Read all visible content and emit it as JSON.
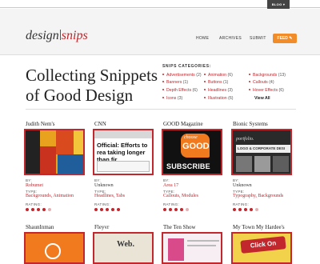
{
  "topbar": {
    "blog_label": "BLOG ▾"
  },
  "header": {
    "logo_left": "design",
    "logo_right": "snips",
    "nav": [
      "HOME",
      "ARCHIVES",
      "SUBMIT"
    ],
    "feed_label": "FEED ✎"
  },
  "hero": {
    "headline": "Collecting Snippets of Good Design"
  },
  "categories": {
    "title": "SNIPS CATEGORIES:",
    "items": [
      {
        "label": "Advertisements",
        "count": "(2)"
      },
      {
        "label": "Banners",
        "count": "(1)"
      },
      {
        "label": "Depth Effects",
        "count": "(6)"
      },
      {
        "label": "Icons",
        "count": "(3)"
      },
      {
        "label": "Animation",
        "count": "(6)"
      },
      {
        "label": "Buttons",
        "count": "(1)"
      },
      {
        "label": "Headlines",
        "count": "(3)"
      },
      {
        "label": "Illustration",
        "count": "(6)"
      },
      {
        "label": "Backgrounds",
        "count": "(13)"
      },
      {
        "label": "Callouts",
        "count": "(4)"
      },
      {
        "label": "Hover Effects",
        "count": "(6)"
      }
    ],
    "view_all": "View All"
  },
  "cards": [
    {
      "title": "Judith Nem's",
      "by": "Robumet",
      "by_link": true,
      "types": "Backgrounds, Animation",
      "rating": 4
    },
    {
      "title": "CNN",
      "by": "Unknown",
      "by_link": false,
      "types": "Headlines, Tabs",
      "rating": 5,
      "thumb_text": "Official: Efforts to rea taking longer than fir"
    },
    {
      "title": "GOOD Magazine",
      "by": "Area 17",
      "by_link": true,
      "types": "Callouts, Modules",
      "rating": 4,
      "thumb_text_top": "choose",
      "thumb_text_mid": "GOOD",
      "thumb_text_bottom": "SUBSCRIBE"
    },
    {
      "title": "Bionic Systems",
      "by": "Unknown",
      "by_link": false,
      "types": "Typography, Backgrounds",
      "rating": 4,
      "thumb_text": "portfolio.",
      "thumb_text2": "LOGO & CORPORATE DESI"
    }
  ],
  "labels": {
    "by": "BY:",
    "type": "TYPE:",
    "rating": "RATING:"
  },
  "bottom_cards": [
    {
      "title": "ShaunInman"
    },
    {
      "title": "Fleyvr",
      "thumb_text": "Web."
    },
    {
      "title": "The Ten Show"
    },
    {
      "title": "My Town My Hardee's",
      "thumb_text": "Click On"
    }
  ],
  "colors": {
    "accent": "#c1272d",
    "feed": "#f28c28"
  }
}
